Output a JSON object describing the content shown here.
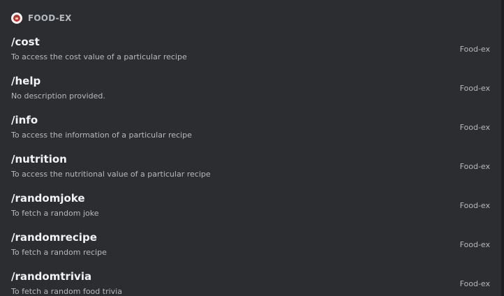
{
  "app": {
    "name": "FOOD-EX",
    "icon": "food-ex-app-icon"
  },
  "commands": [
    {
      "name": "/cost",
      "description": "To access the cost value of a particular recipe",
      "source": "Food-ex"
    },
    {
      "name": "/help",
      "description": "No description provided.",
      "source": "Food-ex"
    },
    {
      "name": "/info",
      "description": "To access the information of a particular recipe",
      "source": "Food-ex"
    },
    {
      "name": "/nutrition",
      "description": "To access the nutritional value of a particular recipe",
      "source": "Food-ex"
    },
    {
      "name": "/randomjoke",
      "description": "To fetch a random joke",
      "source": "Food-ex"
    },
    {
      "name": "/randomrecipe",
      "description": "To fetch a random recipe",
      "source": "Food-ex"
    },
    {
      "name": "/randomtrivia",
      "description": "To fetch a random food trivia",
      "source": "Food-ex"
    }
  ],
  "colors": {
    "background": "#2b2d31",
    "command_text": "#f2f3f5",
    "secondary_text": "#b5bac1",
    "icon_red": "#c7312b"
  }
}
